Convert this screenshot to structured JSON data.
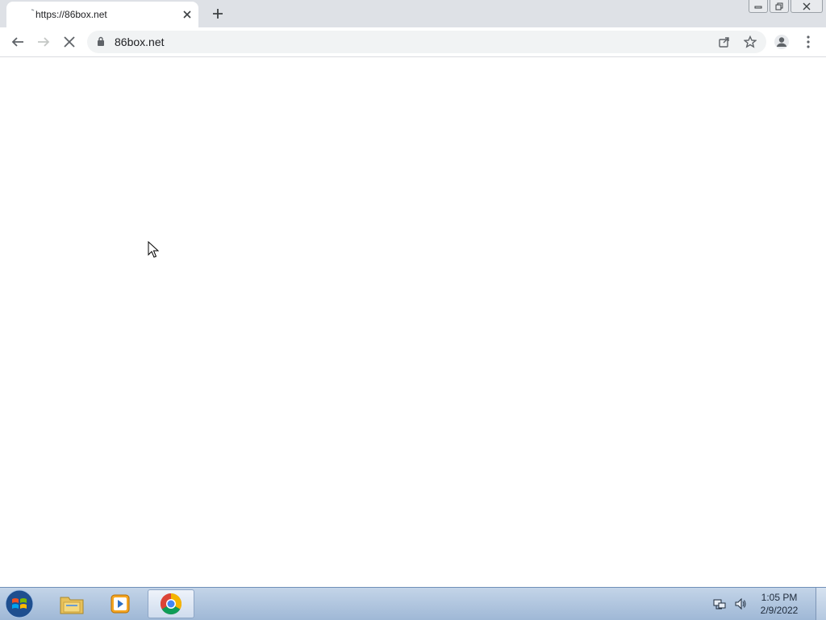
{
  "browser": {
    "tab": {
      "title": "https://86box.net",
      "close_icon": "close-icon"
    },
    "new_tab_icon": "plus-icon",
    "window_controls": [
      "minimize-icon",
      "restore-icon",
      "close-icon"
    ],
    "toolbar": {
      "back_icon": "arrow-left-icon",
      "forward_icon": "arrow-right-icon",
      "stop_icon": "stop-loading-icon",
      "url": "86box.net",
      "lock_icon": "lock-icon",
      "share_icon": "share-icon",
      "bookmark_icon": "star-icon",
      "profile_icon": "profile-icon",
      "menu_icon": "kebab-menu-icon"
    }
  },
  "page": {
    "content": ""
  },
  "taskbar": {
    "start_icon": "windows-start-icon",
    "items": [
      {
        "name": "file-explorer",
        "icon": "folder-icon",
        "active": false
      },
      {
        "name": "media-player",
        "icon": "media-player-icon",
        "active": false
      },
      {
        "name": "chrome",
        "icon": "chrome-icon",
        "active": true
      }
    ],
    "tray": {
      "network_icon": "network-icon",
      "volume_icon": "speaker-icon",
      "time": "1:05 PM",
      "date": "2/9/2022"
    }
  },
  "colors": {
    "tabstrip_bg": "#dee1e6",
    "omnibox_bg": "#f1f3f4",
    "taskbar_bg": "#b3c8e2"
  }
}
